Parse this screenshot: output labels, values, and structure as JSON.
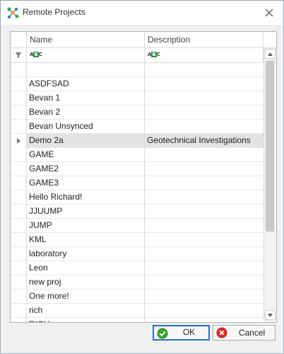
{
  "window": {
    "title": "Remote Projects"
  },
  "columns": {
    "name": "Name",
    "description": "Description"
  },
  "rows": [
    {
      "name": "",
      "description": ""
    },
    {
      "name": "ASDFSAD",
      "description": ""
    },
    {
      "name": "Bevan 1",
      "description": ""
    },
    {
      "name": "Bevan 2",
      "description": ""
    },
    {
      "name": "Bevan Unsynced",
      "description": ""
    },
    {
      "name": "Demo 2a",
      "description": "Geotechnical Investigations",
      "selected": true
    },
    {
      "name": "GAME",
      "description": ""
    },
    {
      "name": "GAME2",
      "description": ""
    },
    {
      "name": "GAME3",
      "description": ""
    },
    {
      "name": "Hello Richard!",
      "description": ""
    },
    {
      "name": "JJUUMP",
      "description": ""
    },
    {
      "name": "JUMP",
      "description": ""
    },
    {
      "name": "KML",
      "description": ""
    },
    {
      "name": "laboratory",
      "description": ""
    },
    {
      "name": "Leon",
      "description": ""
    },
    {
      "name": "new proj",
      "description": ""
    },
    {
      "name": "One more!",
      "description": ""
    },
    {
      "name": "rich",
      "description": ""
    },
    {
      "name": "RICH",
      "description": ""
    }
  ],
  "buttons": {
    "ok": "OK",
    "cancel": "Cancel"
  },
  "icons": {
    "app": "network-nodes-icon",
    "close": "close-icon",
    "filter": "filter-icon",
    "text_filter": "abc-text-filter-icon",
    "row_indicator": "triangle-right-icon",
    "ok": "check-circle-icon",
    "cancel": "x-circle-icon"
  },
  "colors": {
    "ok_border": "#2a6fc9",
    "ok_icon": "#3aa62f",
    "cancel_icon": "#d93025",
    "selected_row": "#e3e3e3"
  }
}
